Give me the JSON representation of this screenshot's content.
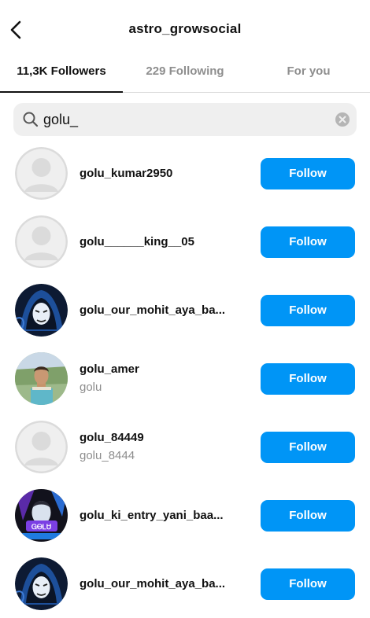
{
  "header": {
    "title": "astro_growsocial",
    "back_icon": "chevron-left-icon"
  },
  "tabs": [
    {
      "label": "11,3K Followers",
      "active": true
    },
    {
      "label": "229 Following",
      "active": false
    },
    {
      "label": "For you",
      "active": false
    }
  ],
  "search": {
    "value": "golu_",
    "icon": "search-icon",
    "clear_icon": "clear-icon"
  },
  "accounts": [
    {
      "username": "golu_kumar2950",
      "subtitle": "",
      "avatar": "default",
      "button": "Follow"
    },
    {
      "username": "golu______king__05",
      "subtitle": "",
      "avatar": "default",
      "button": "Follow"
    },
    {
      "username": "golu_our_mohit_aya_ba...",
      "subtitle": "",
      "avatar": "masked-hood",
      "button": "Follow"
    },
    {
      "username": "golu_amer",
      "subtitle": "golu",
      "avatar": "boy-photo",
      "button": "Follow"
    },
    {
      "username": "golu_84449",
      "subtitle": "golu_8444",
      "avatar": "default",
      "button": "Follow"
    },
    {
      "username": "golu_ki_entry_yani_baa...",
      "subtitle": "",
      "avatar": "game-art",
      "button": "Follow"
    },
    {
      "username": "golu_our_mohit_aya_ba...",
      "subtitle": "",
      "avatar": "masked-hood",
      "button": "Follow"
    }
  ],
  "colors": {
    "follow_button": "#0095f6",
    "muted_text": "#8e8e8e",
    "search_bg": "#efefef"
  }
}
